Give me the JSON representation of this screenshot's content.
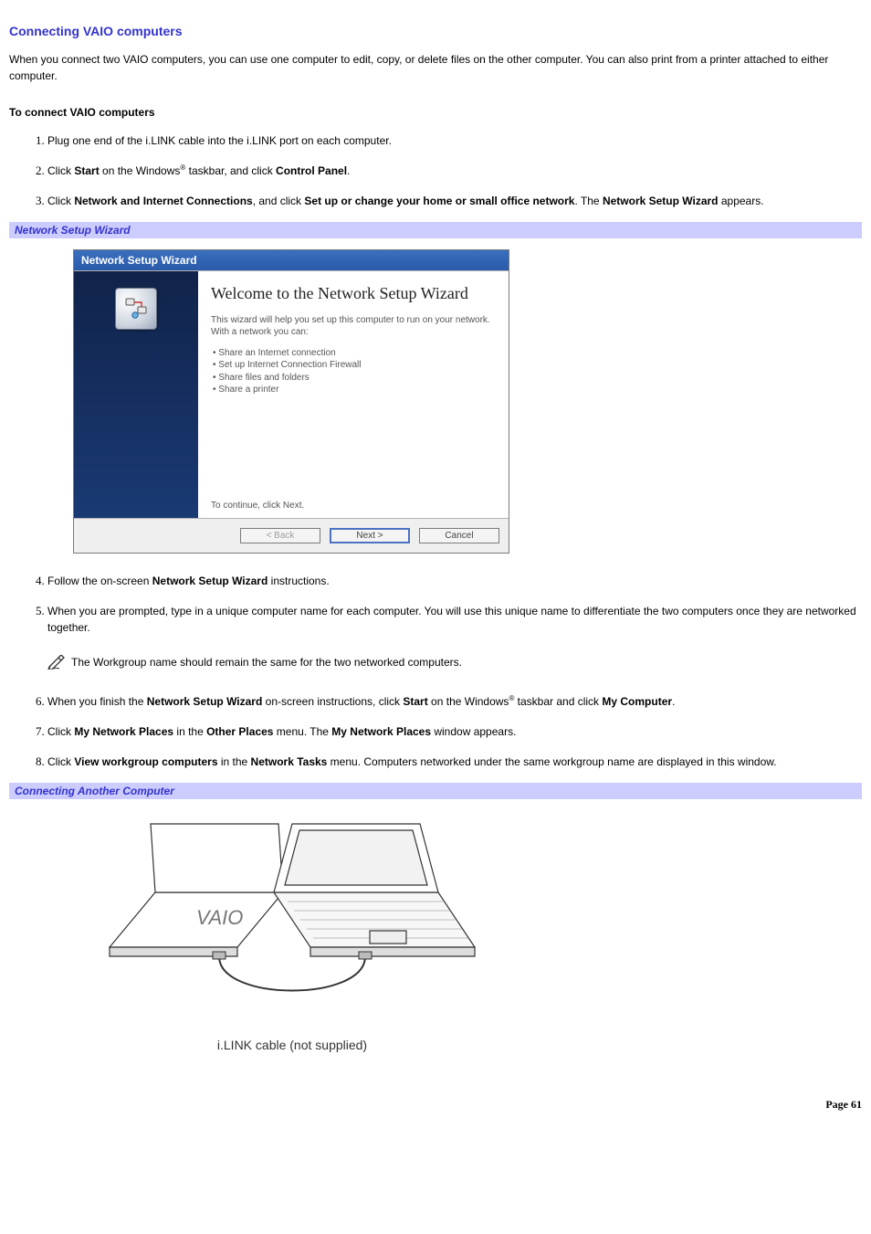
{
  "title": "Connecting VAIO computers",
  "intro": "When you connect two VAIO computers, you can use one computer to edit, copy, or delete files on the other computer. You can also print from a printer attached to either computer.",
  "subheading": "To connect VAIO computers",
  "steps": {
    "s1": "Plug one end of the i.LINK cable into the i.LINK port on each computer.",
    "s2_a": "Click ",
    "s2_b": "Start",
    "s2_c": " on the Windows",
    "s2_d": " taskbar, and click ",
    "s2_e": "Control Panel",
    "s2_f": ".",
    "s3_a": "Click ",
    "s3_b": "Network and Internet Connections",
    "s3_c": ", and click ",
    "s3_d": "Set up or change your home or small office network",
    "s3_e": ". The ",
    "s3_f": "Network Setup Wizard",
    "s3_g": " appears.",
    "s4_a": "Follow the on-screen ",
    "s4_b": "Network Setup Wizard",
    "s4_c": " instructions.",
    "s5": "When you are prompted, type in a unique computer name for each computer. You will use this unique name to differentiate the two computers once they are networked together.",
    "note": "The Workgroup name should remain the same for the two networked computers.",
    "s6_a": "When you finish the ",
    "s6_b": "Network Setup Wizard",
    "s6_c": " on-screen instructions, click ",
    "s6_d": "Start",
    "s6_e": " on the Windows",
    "s6_f": " taskbar and click ",
    "s6_g": "My Computer",
    "s6_h": ".",
    "s7_a": "Click ",
    "s7_b": "My Network Places",
    "s7_c": " in the ",
    "s7_d": "Other Places",
    "s7_e": " menu. The ",
    "s7_f": "My Network Places",
    "s7_g": " window appears.",
    "s8_a": "Click ",
    "s8_b": "View workgroup computers",
    "s8_c": " in the ",
    "s8_d": "Network Tasks",
    "s8_e": " menu. Computers networked under the same workgroup name are displayed in this window."
  },
  "caption1": "Network Setup Wizard",
  "wizard": {
    "titlebar": "Network Setup Wizard",
    "heading": "Welcome to the Network Setup Wizard",
    "sub": "This wizard will help you set up this computer to run on your network. With a network you can:",
    "bullets": [
      "Share an Internet connection",
      "Set up Internet Connection Firewall",
      "Share files and folders",
      "Share a printer"
    ],
    "continue": "To continue, click Next.",
    "btn_back": "< Back",
    "btn_next": "Next >",
    "btn_cancel": "Cancel"
  },
  "caption2": "Connecting Another Computer",
  "illus_caption": "i.LINK cable (not supplied)",
  "vaio_logo": "VAIO",
  "reg_mark": "®",
  "footer": "Page 61"
}
